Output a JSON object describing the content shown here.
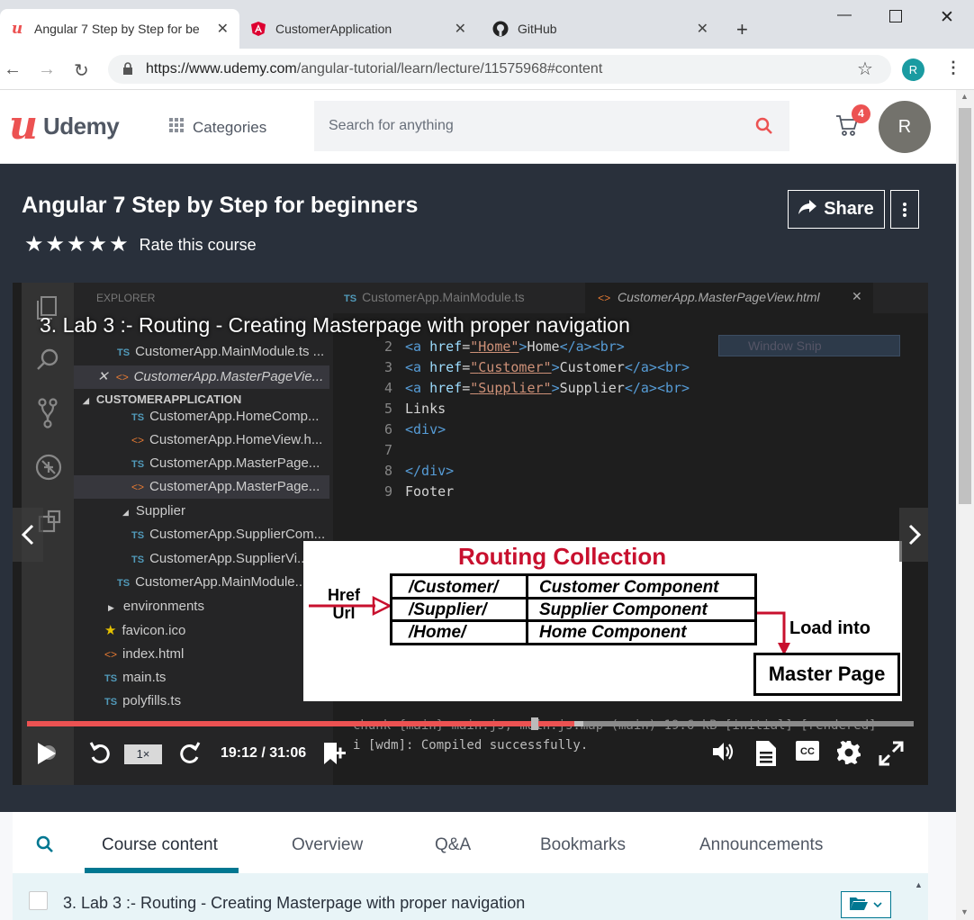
{
  "browser": {
    "tabs": [
      {
        "label": "Angular 7 Step by Step for be",
        "icon": "udemy-icon",
        "active": true
      },
      {
        "label": "CustomerApplication",
        "icon": "angular-icon",
        "active": false
      },
      {
        "label": "GitHub",
        "icon": "github-icon",
        "active": false
      }
    ],
    "url_host": "https://www.udemy.com",
    "url_path": "/angular-tutorial/learn/lecture/11575968#content",
    "profile_initial": "R"
  },
  "header": {
    "logo_text": "Udemy",
    "categories_label": "Categories",
    "search_placeholder": "Search for anything",
    "cart_count": "4",
    "avatar_initial": "R"
  },
  "course": {
    "title": "Angular 7 Step by Step for beginners",
    "rating_stars": 5,
    "rate_label": "Rate this course",
    "share_label": "Share"
  },
  "video": {
    "lecture_title": "3. Lab 3 :- Routing - Creating Masterpage with proper navigation",
    "current_time": "19:12",
    "total_time": "31:06",
    "time_display": "19:12 / 31:06",
    "speed": "1×",
    "progress": 0.617,
    "buffered": 0.627,
    "editor": {
      "explorer_label": "EXPLORER",
      "tabs": [
        "CustomerApp.MainModule.ts",
        "CustomerApp.MasterPageView.html"
      ],
      "tree": [
        {
          "type": "ts",
          "label": "CustomerApp.MainModule.ts ..."
        },
        {
          "type": "html",
          "label": "CustomerApp.MasterPageVie..."
        },
        {
          "type": "folder",
          "label": "CUSTOMERAPPLICATION"
        },
        {
          "type": "ts",
          "label": "CustomerApp.HomeComp..."
        },
        {
          "type": "html",
          "label": "CustomerApp.HomeView.h..."
        },
        {
          "type": "ts",
          "label": "CustomerApp.MasterPage..."
        },
        {
          "type": "html",
          "label": "CustomerApp.MasterPage..."
        },
        {
          "type": "folder",
          "label": "Supplier"
        },
        {
          "type": "ts",
          "label": "CustomerApp.SupplierCom..."
        },
        {
          "type": "ts",
          "label": "CustomerApp.SupplierVi..."
        },
        {
          "type": "ts",
          "label": "CustomerApp.MainModule..."
        },
        {
          "type": "folder",
          "label": "environments"
        },
        {
          "type": "star",
          "label": "favicon.ico"
        },
        {
          "type": "html",
          "label": "index.html"
        },
        {
          "type": "ts",
          "label": "main.ts"
        },
        {
          "type": "ts",
          "label": "polyfills.ts"
        }
      ],
      "code": [
        {
          "n": "2",
          "html": "home"
        },
        {
          "n": "3",
          "html": "customer"
        },
        {
          "n": "4",
          "html": "supplier"
        },
        {
          "n": "5",
          "text": "Links"
        },
        {
          "n": "6",
          "text": "<div>"
        },
        {
          "n": "7",
          "text": ""
        },
        {
          "n": "8",
          "text": "</div>"
        },
        {
          "n": "9",
          "text": "Footer"
        }
      ],
      "line2": {
        "href": "Home",
        "text": "Home"
      },
      "line3": {
        "href": "Customer",
        "text": "Customer"
      },
      "line4": {
        "href": "Supplier",
        "text": "Supplier"
      },
      "terminal": [
        "chunk {main} main.js, main.js.map (main) 19.6 kB [initial] [rendered]",
        "i [wdm]: Compiled successfully."
      ],
      "window_snip": "Window Snip"
    },
    "diagram": {
      "title": "Routing Collection",
      "href_label_1": "Href",
      "href_label_2": "Url",
      "rows": [
        {
          "route": "/Customer/",
          "component": "Customer Component"
        },
        {
          "route": "/Supplier/",
          "component": "Supplier Component"
        },
        {
          "route": "/Home/",
          "component": "Home Component"
        }
      ],
      "load_into": "Load into",
      "master_page": "Master Page"
    }
  },
  "bottom_tabs": [
    "Course content",
    "Overview",
    "Q&A",
    "Bookmarks",
    "Announcements"
  ],
  "lecture_item": "3. Lab 3 :- Routing - Creating Masterpage with proper navigation",
  "colors": {
    "udemy_red": "#ec5252",
    "dark_bg": "#29303b",
    "teal": "#007791"
  }
}
